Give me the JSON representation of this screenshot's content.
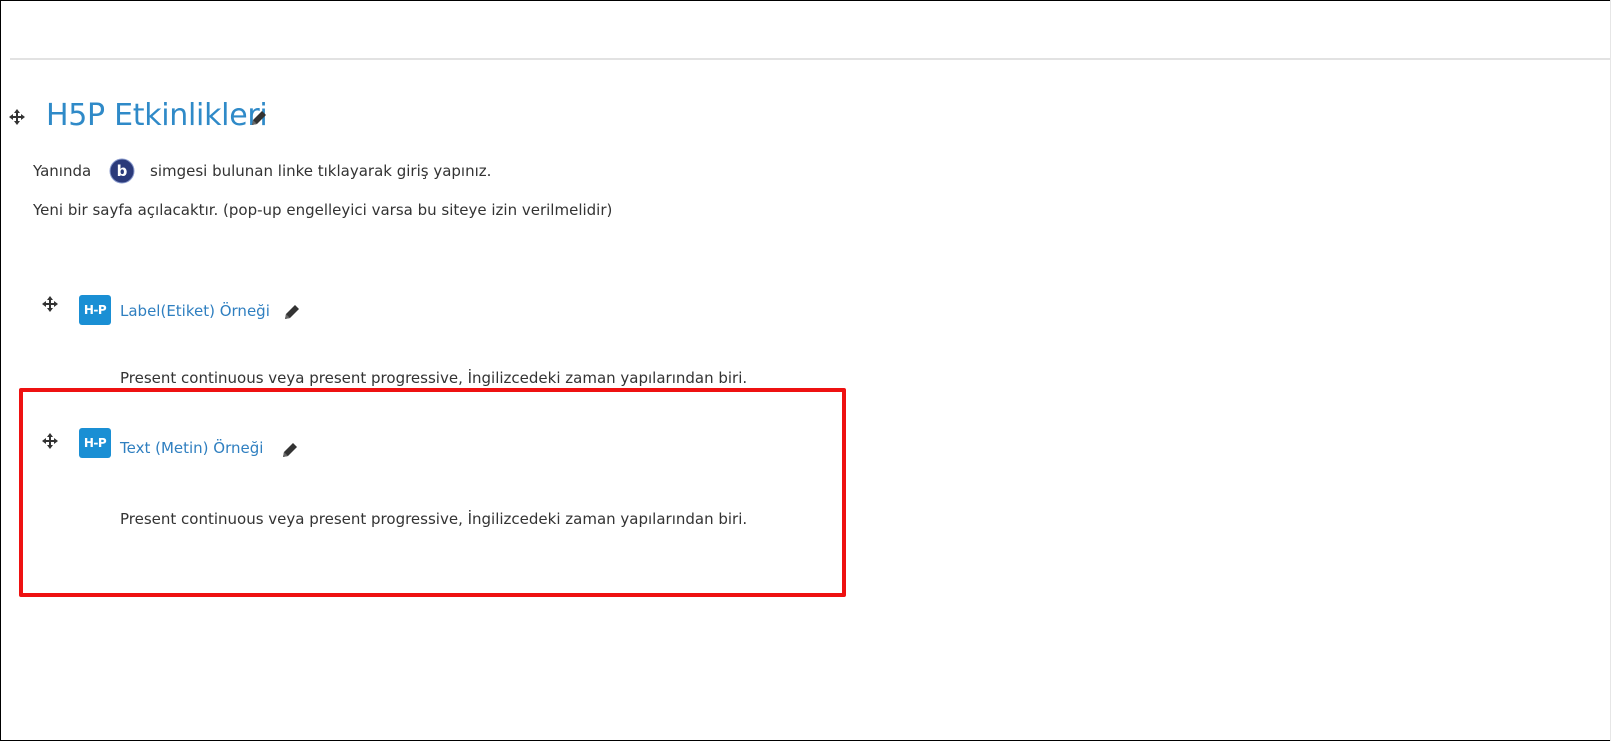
{
  "section": {
    "title": "H5P Etkinlikleri",
    "summary_line1_before": "Yanında",
    "summary_line1_after": "simgesi  bulunan linke tıklayarak giriş yapınız.",
    "summary_line2": "Yeni bir sayfa açılacaktır.  (pop-up engelleyici varsa bu siteye izin verilmelidir)"
  },
  "activities": [
    {
      "name": "Label(Etiket) Örneği",
      "description": "Present continuous veya present progressive, İngilizcedeki zaman yapılarından biri.",
      "icon": "h5p-icon",
      "icon_text": "H-P"
    },
    {
      "name": "Text (Metin) Örneği",
      "description": "Present continuous veya present progressive, İngilizcedeki zaman yapılarından biri.",
      "icon": "h5p-icon",
      "icon_text": "H-P"
    }
  ],
  "colors": {
    "link": "#2f7fc0",
    "title": "#2f8ac8",
    "h5p_badge": "#1a8fd4",
    "highlight": "#ee1111"
  },
  "icons": [
    "move-icon",
    "edit-pencil-icon",
    "b-badge-icon",
    "h5p-icon"
  ]
}
